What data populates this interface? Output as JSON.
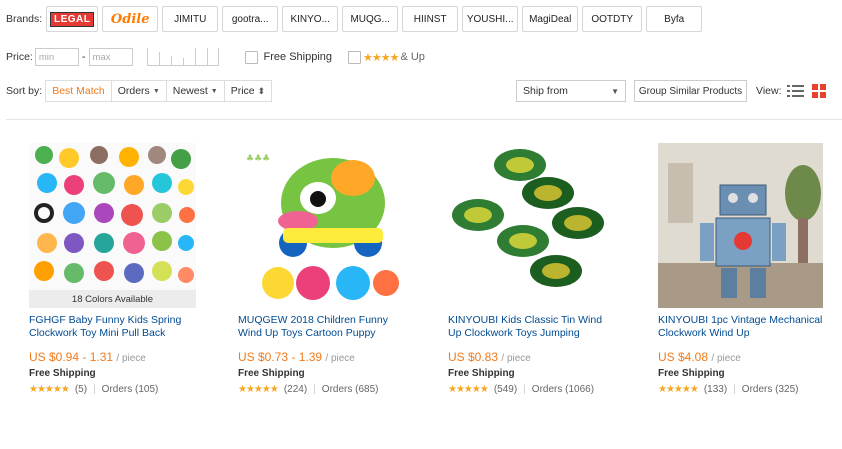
{
  "filters": {
    "brands_label": "Brands:",
    "brands": [
      {
        "label": "LEGAL",
        "style": "logo-red"
      },
      {
        "label": "Odile",
        "style": "logo-orange"
      },
      {
        "label": "JIMITU"
      },
      {
        "label": "gootra..."
      },
      {
        "label": "KINYO..."
      },
      {
        "label": "MUQG..."
      },
      {
        "label": "HIINST"
      },
      {
        "label": "YOUSHI..."
      },
      {
        "label": "MagiDeal"
      },
      {
        "label": "OOTDTY"
      },
      {
        "label": "Byfa"
      }
    ],
    "price_label": "Price:",
    "price_min_placeholder": "min",
    "price_separator": "-",
    "price_max_placeholder": "max",
    "free_shipping_label": "Free Shipping",
    "rating_stars": "★★★★",
    "rating_label": "& Up"
  },
  "sort": {
    "label": "Sort by:",
    "options": [
      "Best Match",
      "Orders",
      "Newest",
      "Price"
    ],
    "active": "Best Match",
    "ship_from_label": "Ship from",
    "group_similar_label": "Group Similar Products",
    "view_label": "View:"
  },
  "colors": {
    "accent": "#f27a1a",
    "link": "#004b91",
    "star": "#f5a623",
    "grid_icon": "#e8412c"
  },
  "products": [
    {
      "colors_available": "18 Colors Available",
      "title": "FGHGF Baby Funny Kids Spring Clockwork Toy Mini Pull Back",
      "price": "US $0.94 - 1.31",
      "unit": "/ piece",
      "shipping": "Free Shipping",
      "stars": "★★★★★",
      "reviews": "(5)",
      "orders": "Orders (105)",
      "image": "assorted-toys-icon"
    },
    {
      "title": "MUQGEW 2018 Children Funny Wind Up Toys Cartoon Puppy",
      "price": "US $0.73 - 1.39",
      "unit": "/ piece",
      "shipping": "Free Shipping",
      "stars": "★★★★★",
      "reviews": "(224)",
      "orders": "Orders (685)",
      "image": "toy-car-icon"
    },
    {
      "title": "KINYOUBI Kids Classic Tin Wind Up Clockwork Toys Jumping",
      "price": "US $0.83",
      "unit": "/ piece",
      "shipping": "Free Shipping",
      "stars": "★★★★★",
      "reviews": "(549)",
      "orders": "Orders (1066)",
      "image": "tin-frogs-icon"
    },
    {
      "title": "KINYOUBI 1pc Vintage Mechanical Clockwork Wind Up",
      "price": "US $4.08",
      "unit": "/ piece",
      "shipping": "Free Shipping",
      "stars": "★★★★★",
      "reviews": "(133)",
      "orders": "Orders (325)",
      "image": "tin-robot-icon"
    }
  ]
}
